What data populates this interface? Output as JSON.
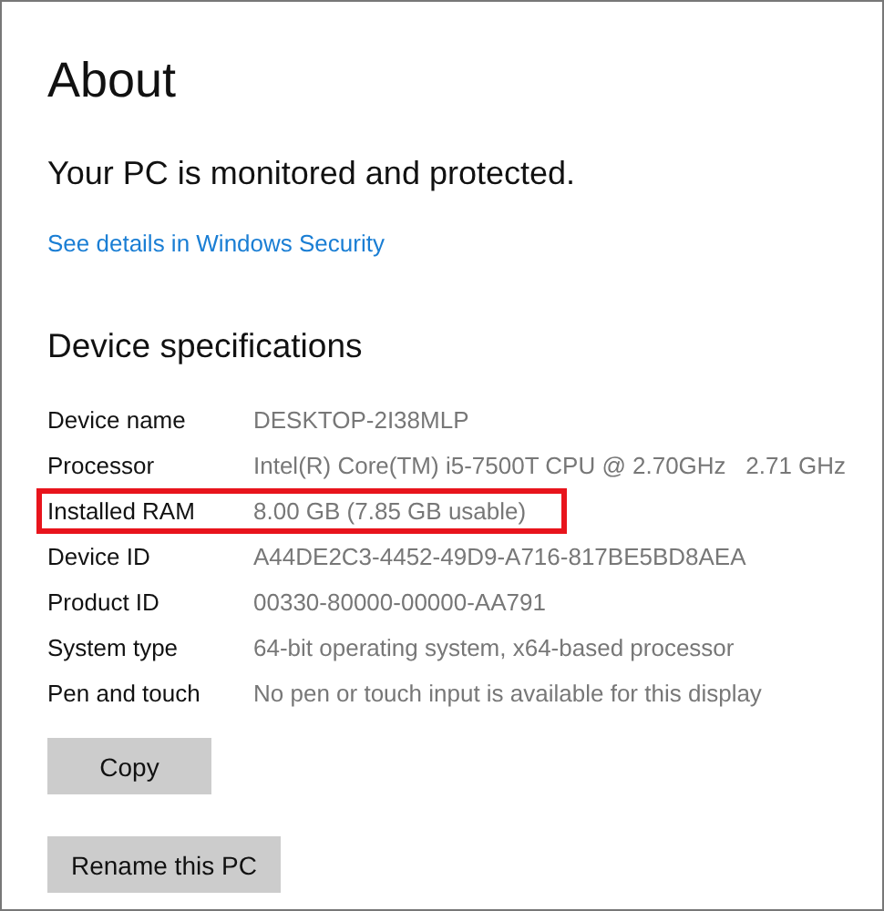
{
  "title": "About",
  "protection_status": "Your PC is monitored and protected.",
  "security_link": "See details in Windows Security",
  "section_heading": "Device specifications",
  "specs": [
    {
      "label": "Device name",
      "value": "DESKTOP-2I38MLP",
      "highlighted": false
    },
    {
      "label": "Processor",
      "value": "Intel(R) Core(TM) i5-7500T CPU @ 2.70GHz   2.71 GHz",
      "highlighted": false
    },
    {
      "label": "Installed RAM",
      "value": "8.00 GB (7.85 GB usable)",
      "highlighted": true
    },
    {
      "label": "Device ID",
      "value": "A44DE2C3-4452-49D9-A716-817BE5BD8AEA",
      "highlighted": false
    },
    {
      "label": "Product ID",
      "value": "00330-80000-00000-AA791",
      "highlighted": false
    },
    {
      "label": "System type",
      "value": "64-bit operating system, x64-based processor",
      "highlighted": false
    },
    {
      "label": "Pen and touch",
      "value": "No pen or touch input is available for this display",
      "highlighted": false
    }
  ],
  "buttons": [
    {
      "label": "Copy"
    },
    {
      "label": "Rename this PC"
    }
  ]
}
